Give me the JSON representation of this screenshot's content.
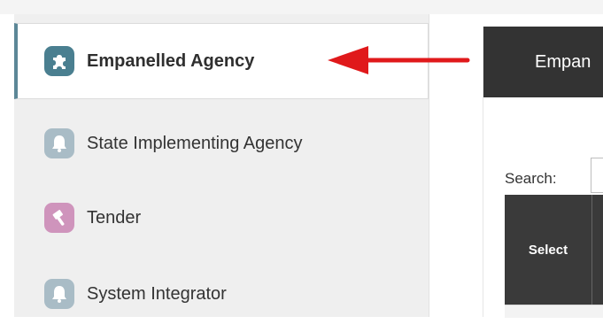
{
  "sidebar": {
    "items": [
      {
        "label": "Empanelled Agency",
        "icon": "puzzle-icon",
        "active": true
      },
      {
        "label": "State Implementing Agency",
        "icon": "bell-icon",
        "active": false
      },
      {
        "label": "Tender",
        "icon": "hammer-icon",
        "active": false
      },
      {
        "label": "System Integrator",
        "icon": "bell-icon",
        "active": false
      }
    ]
  },
  "annotation": {
    "arrow_color": "#e0191b"
  },
  "content": {
    "header_title": "Empan",
    "search_label": "Search:",
    "search_value": "",
    "table_headers": [
      "Select"
    ]
  }
}
